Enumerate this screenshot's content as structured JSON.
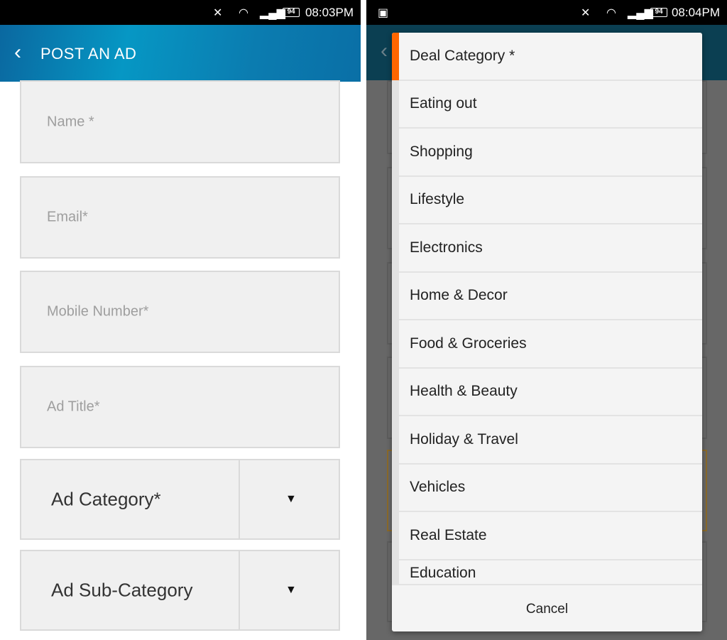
{
  "left": {
    "status": {
      "time": "08:03PM",
      "battery": "94"
    },
    "header": {
      "title": "POST AN AD"
    },
    "fields": [
      {
        "placeholder": "Name *"
      },
      {
        "placeholder": "Email*"
      },
      {
        "placeholder": "Mobile Number*"
      },
      {
        "placeholder": "Ad Title*"
      }
    ],
    "selects": [
      {
        "label": "Ad Category*"
      },
      {
        "label": "Ad Sub-Category"
      }
    ]
  },
  "right": {
    "status": {
      "time": "08:04PM",
      "battery": "94"
    },
    "dialog": {
      "items": [
        "Deal Category *",
        "Eating out",
        "Shopping",
        "Lifestyle",
        "Electronics",
        "Home & Decor",
        "Food & Groceries",
        "Health & Beauty",
        "Holiday & Travel",
        "Vehicles",
        "Real Estate",
        "Education"
      ],
      "selected_index": 0,
      "cancel_label": "Cancel"
    }
  },
  "colors": {
    "accent": "#ff6600",
    "header": "#0697c4"
  }
}
